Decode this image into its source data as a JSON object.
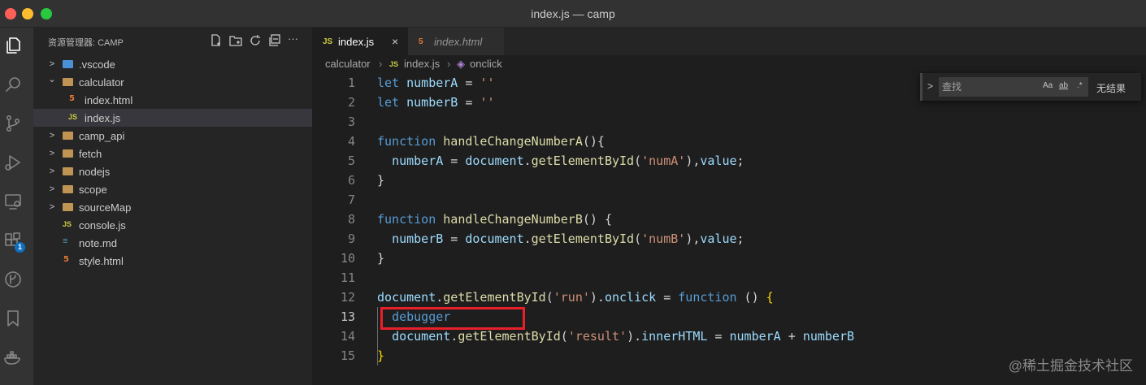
{
  "window": {
    "title": "index.js — camp"
  },
  "activity_bar": {
    "items": [
      {
        "icon": "files-icon",
        "active": true
      },
      {
        "icon": "search-icon"
      },
      {
        "icon": "source-control-icon"
      },
      {
        "icon": "run-debug-icon"
      },
      {
        "icon": "remote-explorer-icon"
      },
      {
        "icon": "extensions-icon",
        "badge": "1"
      },
      {
        "icon": "git-graph-icon"
      },
      {
        "icon": "bookmark-icon"
      },
      {
        "icon": "docker-icon"
      }
    ]
  },
  "sidebar": {
    "title": "资源管理器: CAMP",
    "actions": [
      "new-file-icon",
      "new-folder-icon",
      "refresh-icon",
      "collapse-all-icon",
      "more-icon"
    ],
    "more_label": "···",
    "tree": [
      {
        "label": ".vscode",
        "kind": "folder-vscode",
        "depth": 0,
        "expanded": false,
        "chevron": ">"
      },
      {
        "label": "calculator",
        "kind": "folder",
        "depth": 0,
        "expanded": true,
        "chevron": "⌄"
      },
      {
        "label": "index.html",
        "kind": "html",
        "depth": 1
      },
      {
        "label": "index.js",
        "kind": "js",
        "depth": 1,
        "selected": true
      },
      {
        "label": "camp_api",
        "kind": "folder",
        "depth": 0,
        "expanded": false,
        "chevron": ">"
      },
      {
        "label": "fetch",
        "kind": "folder",
        "depth": 0,
        "expanded": false,
        "chevron": ">"
      },
      {
        "label": "nodejs",
        "kind": "folder",
        "depth": 0,
        "expanded": false,
        "chevron": ">"
      },
      {
        "label": "scope",
        "kind": "folder",
        "depth": 0,
        "expanded": false,
        "chevron": ">"
      },
      {
        "label": "sourceMap",
        "kind": "folder",
        "depth": 0,
        "expanded": false,
        "chevron": ">"
      },
      {
        "label": "console.js",
        "kind": "js",
        "depth": 0
      },
      {
        "label": "note.md",
        "kind": "md",
        "depth": 0
      },
      {
        "label": "style.html",
        "kind": "html",
        "depth": 0
      }
    ]
  },
  "tabs": [
    {
      "label": "index.js",
      "icon": "JS",
      "active": true,
      "close": "×"
    },
    {
      "label": "index.html",
      "icon": "5",
      "active": false,
      "close": ""
    }
  ],
  "breadcrumb": {
    "items": [
      "calculator",
      "index.js",
      "onclick"
    ],
    "js_badge": "JS",
    "sep": "›"
  },
  "editor": {
    "current_line": 13,
    "highlight_line": 13,
    "lines": [
      {
        "n": "1",
        "tokens": [
          [
            "kw",
            "let "
          ],
          [
            "id",
            "numberA"
          ],
          [
            "pu",
            " = "
          ],
          [
            "st",
            "''"
          ]
        ]
      },
      {
        "n": "2",
        "tokens": [
          [
            "kw",
            "let "
          ],
          [
            "id",
            "numberB"
          ],
          [
            "pu",
            " = "
          ],
          [
            "st",
            "''"
          ]
        ]
      },
      {
        "n": "3",
        "tokens": []
      },
      {
        "n": "4",
        "tokens": [
          [
            "kw",
            "function "
          ],
          [
            "fn",
            "handleChangeNumberA"
          ],
          [
            "pu",
            "(){"
          ]
        ]
      },
      {
        "n": "5",
        "tokens": [
          [
            "pu",
            "  "
          ],
          [
            "id",
            "numberA"
          ],
          [
            "pu",
            " = "
          ],
          [
            "id",
            "document"
          ],
          [
            "pu",
            "."
          ],
          [
            "fn",
            "getElementById"
          ],
          [
            "pu",
            "("
          ],
          [
            "st",
            "'numA'"
          ],
          [
            "pu",
            "),"
          ],
          [
            "id",
            "value"
          ],
          [
            "pu",
            ";"
          ]
        ]
      },
      {
        "n": "6",
        "tokens": [
          [
            "pu",
            "}"
          ]
        ]
      },
      {
        "n": "7",
        "tokens": []
      },
      {
        "n": "8",
        "tokens": [
          [
            "kw",
            "function "
          ],
          [
            "fn",
            "handleChangeNumberB"
          ],
          [
            "pu",
            "() {"
          ]
        ]
      },
      {
        "n": "9",
        "tokens": [
          [
            "pu",
            "  "
          ],
          [
            "id",
            "numberB"
          ],
          [
            "pu",
            " = "
          ],
          [
            "id",
            "document"
          ],
          [
            "pu",
            "."
          ],
          [
            "fn",
            "getElementById"
          ],
          [
            "pu",
            "("
          ],
          [
            "st",
            "'numB'"
          ],
          [
            "pu",
            "),"
          ],
          [
            "id",
            "value"
          ],
          [
            "pu",
            ";"
          ]
        ]
      },
      {
        "n": "10",
        "tokens": [
          [
            "pu",
            "}"
          ]
        ]
      },
      {
        "n": "11",
        "tokens": []
      },
      {
        "n": "12",
        "tokens": [
          [
            "id",
            "document"
          ],
          [
            "pu",
            "."
          ],
          [
            "fn",
            "getElementById"
          ],
          [
            "pu",
            "("
          ],
          [
            "st",
            "'run'"
          ],
          [
            "pu",
            ")."
          ],
          [
            "id",
            "onclick"
          ],
          [
            "pu",
            " = "
          ],
          [
            "kw",
            "function"
          ],
          [
            "pu",
            " () "
          ],
          [
            "br",
            "{"
          ]
        ]
      },
      {
        "n": "13",
        "tokens": [
          [
            "pu",
            "  "
          ],
          [
            "kw",
            "debugger"
          ]
        ]
      },
      {
        "n": "14",
        "tokens": [
          [
            "pu",
            "  "
          ],
          [
            "id",
            "document"
          ],
          [
            "pu",
            "."
          ],
          [
            "fn",
            "getElementById"
          ],
          [
            "pu",
            "("
          ],
          [
            "st",
            "'result'"
          ],
          [
            "pu",
            ")."
          ],
          [
            "id",
            "innerHTML"
          ],
          [
            "pu",
            " = "
          ],
          [
            "id",
            "numberA"
          ],
          [
            "pu",
            " + "
          ],
          [
            "id",
            "numberB"
          ]
        ]
      },
      {
        "n": "15",
        "tokens": [
          [
            "br",
            "}"
          ]
        ]
      }
    ]
  },
  "find_widget": {
    "toggle": ">",
    "placeholder": "查找",
    "options": [
      "Aa",
      "ab",
      ".*"
    ],
    "result": "无结果"
  },
  "watermark": "@稀土掘金技术社区",
  "colors": {
    "accent": "#0e70c0",
    "highlight_box": "#e8202a"
  }
}
